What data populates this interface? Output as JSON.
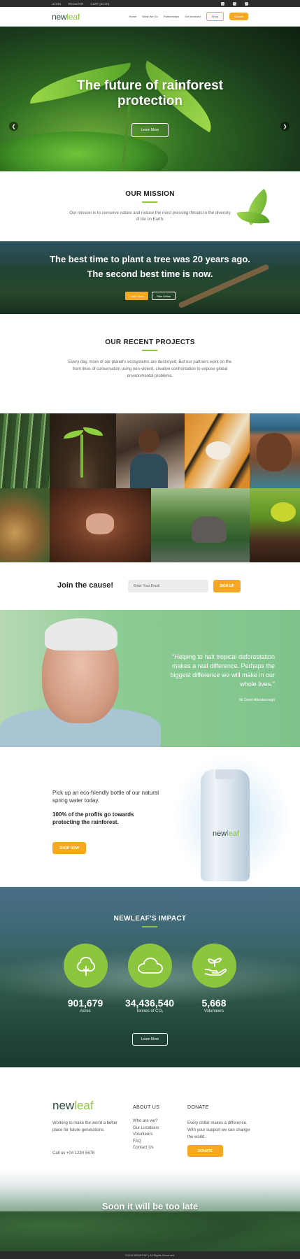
{
  "utility_bar": {
    "links": [
      "LOGIN",
      "REGISTER",
      "CART (£0.00)"
    ],
    "social_icons": [
      "facebook-icon",
      "instagram-icon",
      "twitter-icon"
    ]
  },
  "brand": {
    "name_part1": "new",
    "name_part2": "leaf",
    "accent": "#8cc63f",
    "cta_color": "#f7a823"
  },
  "nav": {
    "items": [
      "Home",
      "What We Do",
      "Partnerships",
      "Get Involved"
    ],
    "shop": "Shop",
    "donate": "Donate"
  },
  "hero": {
    "title": "The future of rainforest protection",
    "button": "Learn More",
    "prev_icon": "chevron-left-icon",
    "next_icon": "chevron-right-icon"
  },
  "mission": {
    "title": "OUR MISSION",
    "text": "Our mission is to conserve nature and reduce the most pressing threats to the diversity of life on Earth."
  },
  "quote_band": {
    "text": "The best time to plant a tree was 20 years ago. The second best time is now.",
    "button_primary": "Learn More",
    "button_secondary": "Take Action"
  },
  "projects": {
    "title": "OUR RECENT PROJECTS",
    "text": "Every day, more of our planet's ecosystems are destroyed. But our partners work on the front lines of conservation using non-violent, creative confrontation to expose global environmental problems."
  },
  "join": {
    "title": "Join the cause!",
    "email_placeholder": "Enter Your Email",
    "button": "SIGN UP"
  },
  "testimonial": {
    "quote": "\"Helping to halt tropical deforestation makes a real difference. Perhaps the biggest difference we will make in our whole lives.\"",
    "author": "Sir David Attenborough"
  },
  "water": {
    "line1": "Pick up an eco-friendly bottle of our natural spring water today.",
    "line2": "100% of the profits go towards protecting the rainforest.",
    "button": "SHOP NOW",
    "bottle_logo_part1": "new",
    "bottle_logo_part2": "leaf"
  },
  "impact": {
    "title": "NEWLEAF'S IMPACT",
    "stats": [
      {
        "value": "901,679",
        "label": "Acres",
        "icon": "tree-icon"
      },
      {
        "value": "34,436,540",
        "label": "Tonnes of CO₂",
        "icon": "cloud-icon"
      },
      {
        "value": "5,668",
        "label": "Volunteers",
        "icon": "hand-seedling-icon"
      }
    ],
    "button": "Learn More"
  },
  "footer": {
    "logo_part1": "new",
    "logo_part2": "leaf",
    "text": "Working to make the world a better place for future generations.",
    "call": "Call us +04 1234 5678",
    "about_title": "ABOUT US",
    "about_links": [
      "Who are we?",
      "Our Locations",
      "Volunteers",
      "FAQ",
      "Contact Us"
    ],
    "donate_title": "DONATE",
    "donate_text": "Every dollar makes a difference. With your support we can change the world.",
    "donate_button": "DONATE"
  },
  "bottom_banner": {
    "title": "Soon it will be too late"
  },
  "copyright": "©2018 NEWLEAF  |  All Rights Reserved."
}
